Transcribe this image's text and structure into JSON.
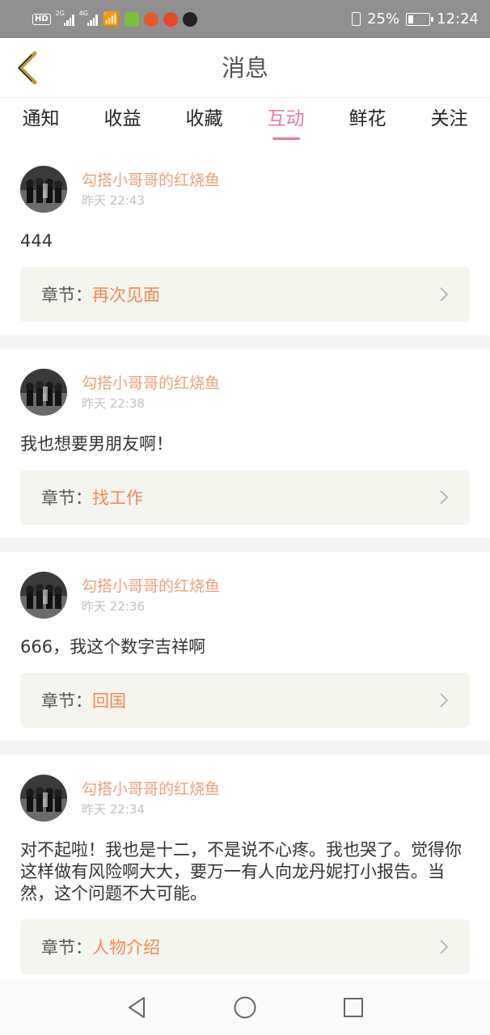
{
  "status_bar": {
    "left_badges": [
      "HD",
      "2G",
      "4G"
    ],
    "battery": "25%",
    "battery_level": 0.25,
    "time": "12:24"
  },
  "header": {
    "title": "消息"
  },
  "tabs": [
    {
      "label": "通知",
      "active": false
    },
    {
      "label": "收益",
      "active": false
    },
    {
      "label": "收藏",
      "active": false
    },
    {
      "label": "互动",
      "active": true
    },
    {
      "label": "鲜花",
      "active": false
    },
    {
      "label": "关注",
      "active": false
    }
  ],
  "colors": {
    "accent": "#e07aa9",
    "username": "#e6a27c",
    "chapter_title": "#ef8a55",
    "chapter_bg": "#f5f5ef"
  },
  "messages": [
    {
      "user": "勾搭小哥哥的红烧鱼",
      "time": "昨天 22:43",
      "text": "444",
      "chapter_label": "章节：",
      "chapter": "再次见面"
    },
    {
      "user": "勾搭小哥哥的红烧鱼",
      "time": "昨天 22:38",
      "text": "我也想要男朋友啊！",
      "chapter_label": "章节：",
      "chapter": "找工作"
    },
    {
      "user": "勾搭小哥哥的红烧鱼",
      "time": "昨天 22:36",
      "text": "666，我这个数字吉祥啊",
      "chapter_label": "章节：",
      "chapter": "回国"
    },
    {
      "user": "勾搭小哥哥的红烧鱼",
      "time": "昨天 22:34",
      "text": "对不起啦！我也是十二，不是说不心疼。我也哭了。觉得你这样做有风险啊大大，要万一有人向龙丹妮打小报告。当然，这个问题不大可能。",
      "chapter_label": "章节：",
      "chapter": "人物介绍"
    }
  ],
  "icons": {
    "back": "chevron-left-icon",
    "chapter_arrow": "chevron-right-icon",
    "nav_back": "triangle-back-icon",
    "nav_home": "circle-home-icon",
    "nav_recent": "square-recents-icon"
  }
}
